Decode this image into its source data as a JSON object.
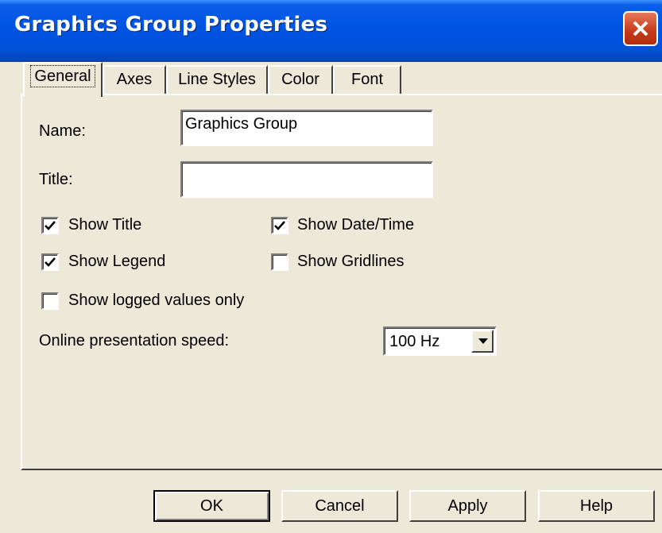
{
  "window": {
    "title": "Graphics Group Properties"
  },
  "tabs": [
    {
      "label": "General",
      "active": true
    },
    {
      "label": "Axes",
      "active": false
    },
    {
      "label": "Line Styles",
      "active": false
    },
    {
      "label": "Color",
      "active": false
    },
    {
      "label": "Font",
      "active": false
    }
  ],
  "general": {
    "name_label": "Name:",
    "name_value": "Graphics Group",
    "title_label": "Title:",
    "title_value": "",
    "show_title": {
      "label": "Show Title",
      "checked": true
    },
    "show_datetime": {
      "label": "Show Date/Time",
      "checked": true
    },
    "show_legend": {
      "label": "Show Legend",
      "checked": true
    },
    "show_gridlines": {
      "label": "Show Gridlines",
      "checked": false
    },
    "show_logged": {
      "label": "Show logged values only",
      "checked": false
    },
    "speed_label": "Online presentation speed:",
    "speed_value": "100 Hz"
  },
  "buttons": {
    "ok": "OK",
    "cancel": "Cancel",
    "apply": "Apply",
    "help": "Help"
  },
  "colors": {
    "titlebar": "#0054E3",
    "face": "#ECE9D8",
    "close": "#C53A18"
  }
}
